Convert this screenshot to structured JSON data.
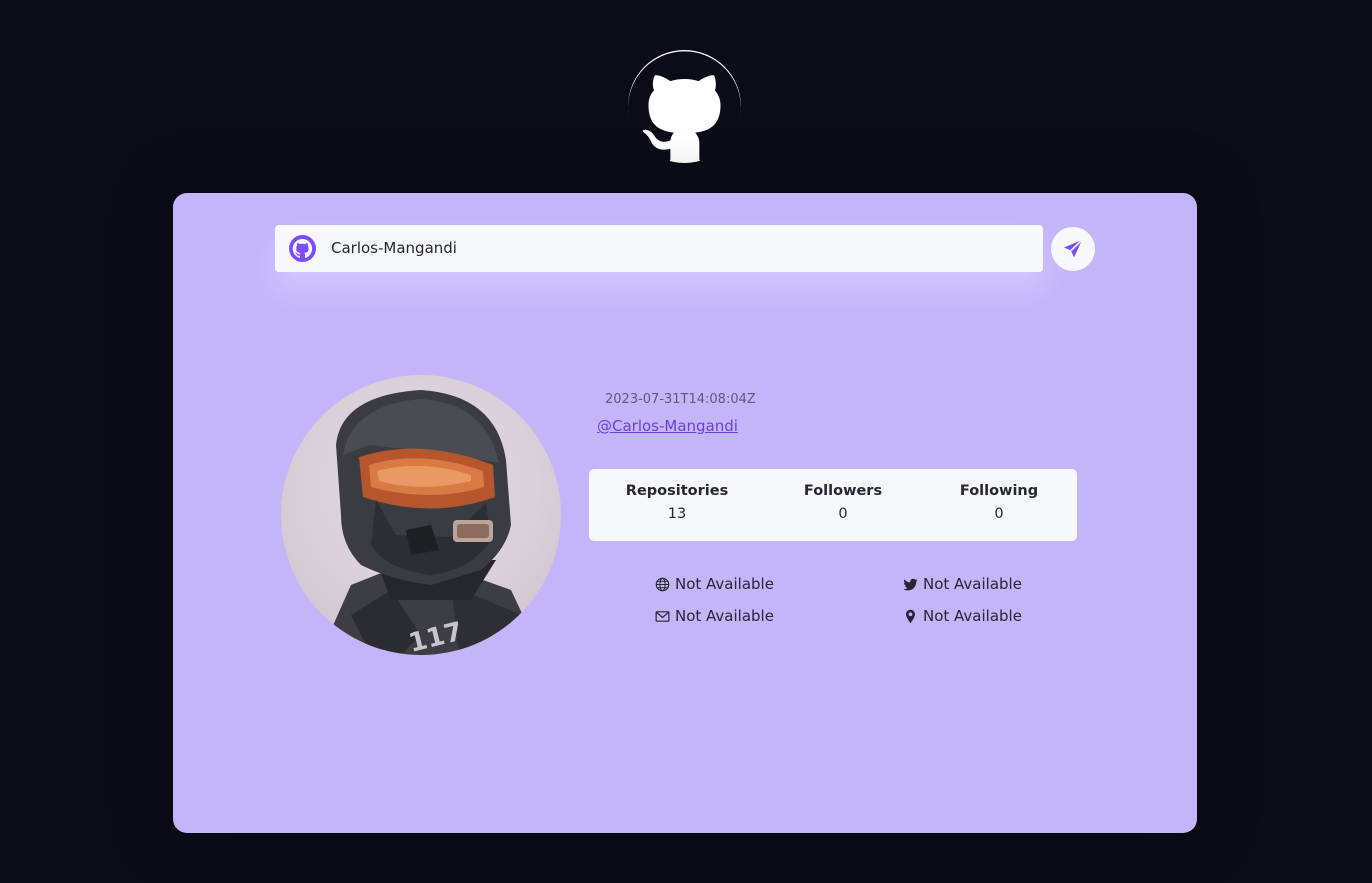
{
  "search": {
    "value": "Carlos-Mangandi",
    "placeholder": ""
  },
  "profile": {
    "created_at": "2023-07-31T14:08:04Z",
    "login": "@Carlos-Mangandi"
  },
  "stats": [
    {
      "label": "Repositories",
      "value": "13"
    },
    {
      "label": "Followers",
      "value": "0"
    },
    {
      "label": "Following",
      "value": "0"
    }
  ],
  "info": {
    "blog": "Not Available",
    "twitter": "Not Available",
    "email": "Not Available",
    "location": "Not Available"
  },
  "icons": {
    "logo": "github-logo-icon",
    "search": "github-icon",
    "send": "paper-plane-icon",
    "blog": "globe-icon",
    "twitter": "twitter-icon",
    "email": "mail-icon",
    "location": "map-pin-icon"
  },
  "colors": {
    "page_background": "#0b0c18",
    "card_background": "#c4b5fb",
    "accent": "#7c4dff",
    "surface": "#f7f8fb",
    "text": "#262733"
  }
}
